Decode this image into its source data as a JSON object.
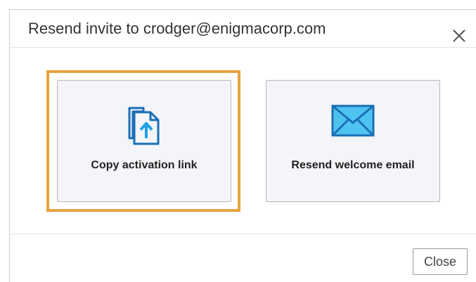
{
  "dialog": {
    "title": "Resend invite to crodger@enigmacorp.com",
    "close_icon": "close-icon"
  },
  "options": [
    {
      "label": "Copy activation link",
      "icon": "copy-link-icon",
      "focused": true
    },
    {
      "label": "Resend welcome email",
      "icon": "envelope-icon",
      "focused": false
    }
  ],
  "footer": {
    "close_label": "Close"
  },
  "colors": {
    "accent_blue": "#1a6fb5",
    "arrow_blue": "#1ea1e8",
    "envelope_fill": "#4fc3f0",
    "focus_ring": "#e8a33d",
    "card_bg": "#f3f5f8"
  }
}
